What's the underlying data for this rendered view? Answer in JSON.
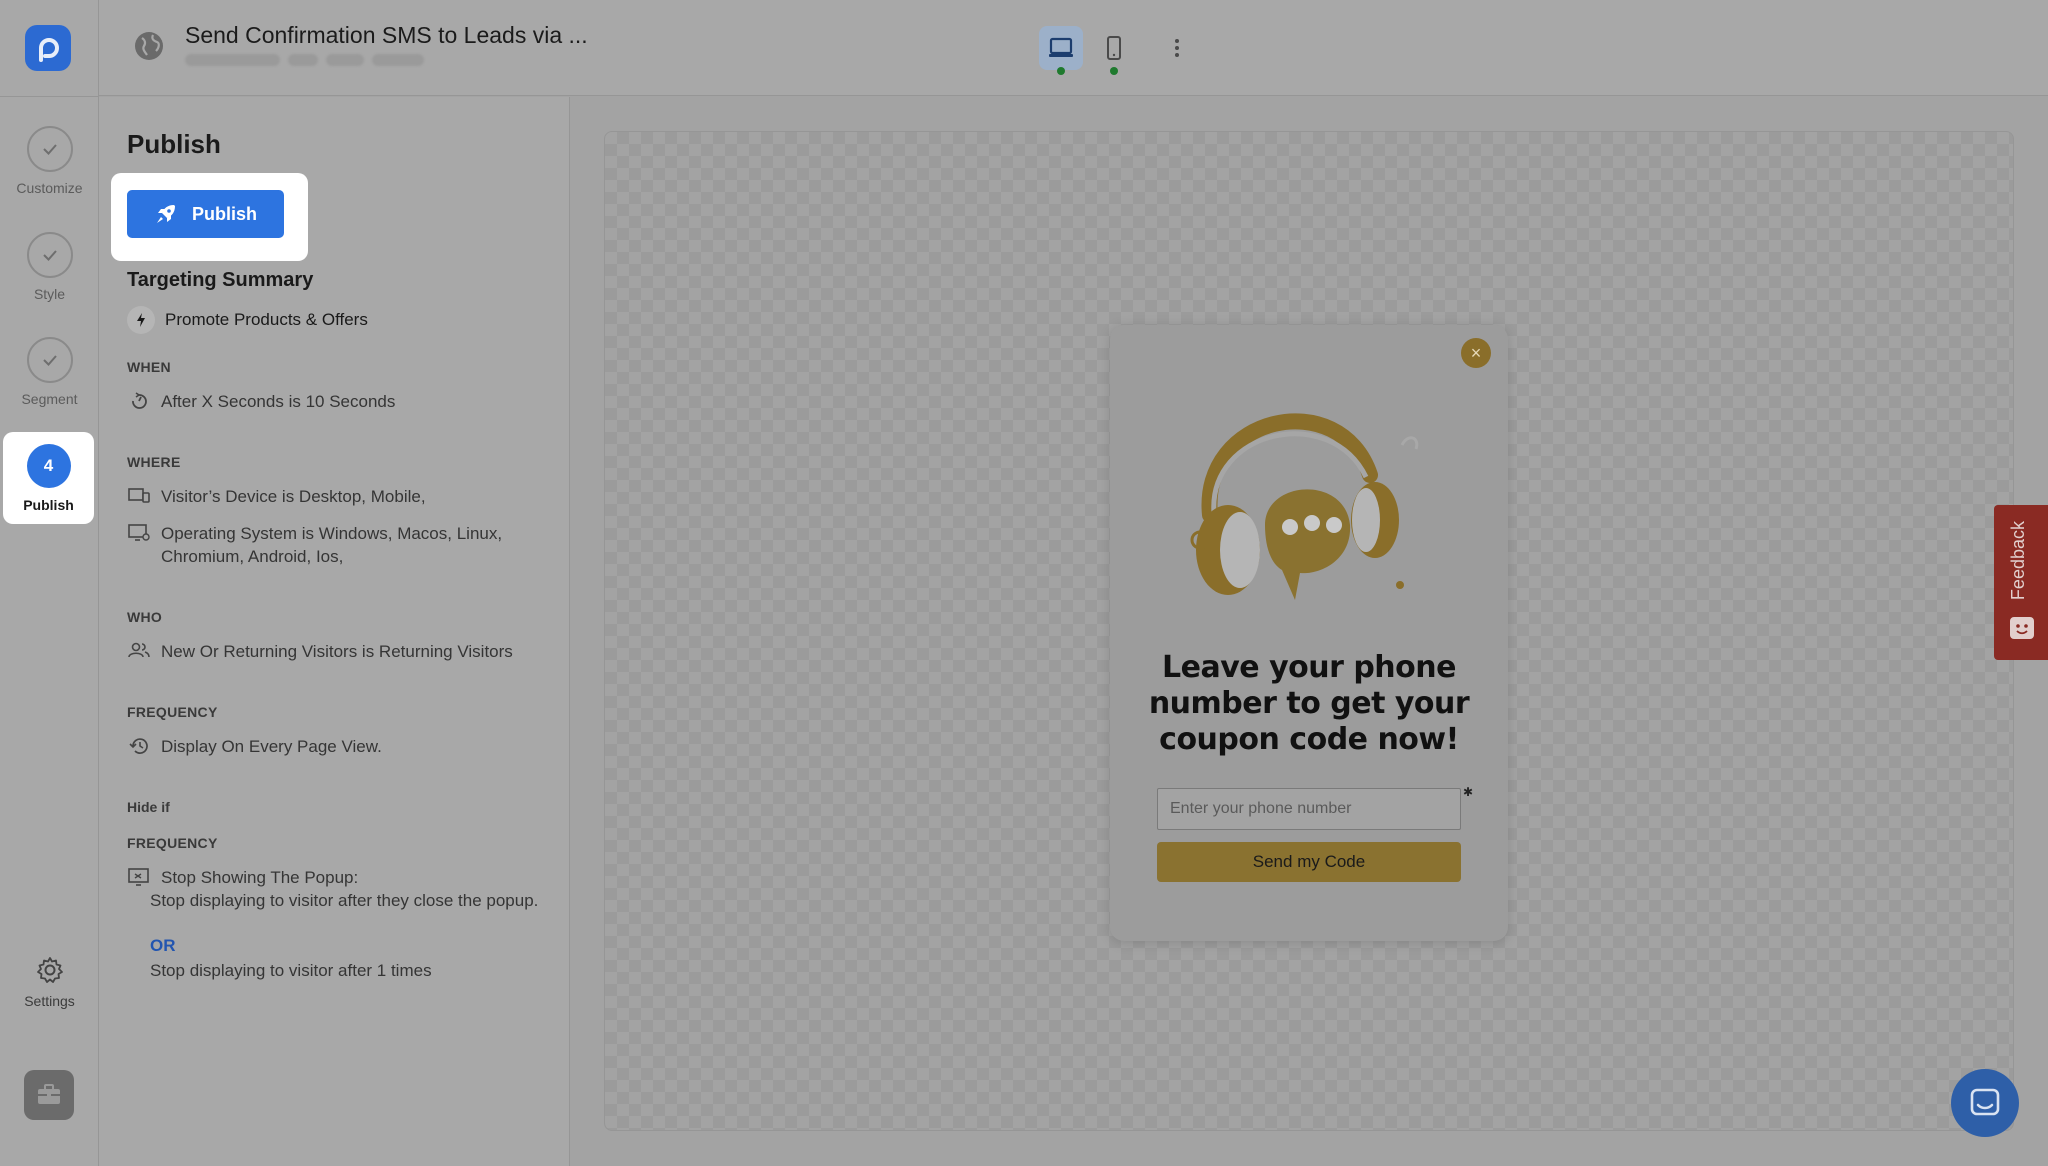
{
  "header": {
    "title": "Send Confirmation SMS to Leads via ...",
    "icons": {
      "site": "globe-icon",
      "desktop": "desktop-icon",
      "mobile": "mobile-icon",
      "more": "more-vertical-icon"
    }
  },
  "sidebar": {
    "logo": "app-logo",
    "steps": [
      {
        "label": "Customize",
        "state": "done"
      },
      {
        "label": "Style",
        "state": "done"
      },
      {
        "label": "Segment",
        "state": "done"
      },
      {
        "label": "Publish",
        "number": "4",
        "state": "active"
      }
    ],
    "settings_label": "Settings"
  },
  "panel": {
    "title": "Publish",
    "publish_button": "Publish",
    "targeting_title": "Targeting Summary",
    "goal": "Promote Products & Offers",
    "when": {
      "label": "WHEN",
      "rules": [
        "After X Seconds is 10 Seconds"
      ]
    },
    "where": {
      "label": "WHERE",
      "rules": [
        "Visitor’s Device is Desktop, Mobile,",
        "Operating System is Windows, Macos, Linux, Chromium, Android, Ios,"
      ]
    },
    "who": {
      "label": "WHO",
      "rules": [
        "New Or Returning Visitors is Returning Visitors"
      ]
    },
    "frequency": {
      "label": "FREQUENCY",
      "rules": [
        "Display On Every Page View."
      ]
    },
    "hide_if": {
      "label": "Hide if",
      "frequency_label": "FREQUENCY",
      "rule_title": "Stop Showing The Popup:",
      "line1": "Stop displaying to visitor after they close the popup.",
      "or": "OR",
      "line2": "Stop displaying to visitor after 1 times"
    }
  },
  "popup": {
    "heading": "Leave your phone number to get your coupon code now!",
    "input_placeholder": "Enter your phone number",
    "button": "Send my Code",
    "accent": "#8a7230"
  },
  "feedback_label": "Feedback",
  "colors": {
    "primary": "#2d74e0",
    "feedback": "#8a2a23",
    "chat": "#2e5fa8"
  }
}
